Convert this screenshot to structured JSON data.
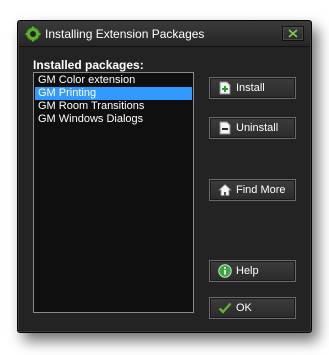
{
  "window": {
    "title": "Installing Extension Packages",
    "app_icon": "gear-icon",
    "close_icon": "close-icon"
  },
  "packages": {
    "label": "Installed packages:",
    "items": [
      {
        "name": "GM Color extension",
        "selected": false
      },
      {
        "name": "GM Printing",
        "selected": true
      },
      {
        "name": "GM Room Transitions",
        "selected": false
      },
      {
        "name": "GM Windows Dialogs",
        "selected": false
      }
    ]
  },
  "buttons": {
    "install": {
      "label": "Install",
      "icon": "install-icon"
    },
    "uninstall": {
      "label": "Uninstall",
      "icon": "uninstall-icon"
    },
    "find_more": {
      "label": "Find More",
      "icon": "home-icon"
    },
    "help": {
      "label": "Help",
      "icon": "info-icon"
    },
    "ok": {
      "label": "OK",
      "icon": "checkmark-icon"
    }
  },
  "colors": {
    "accent": "#3399ff",
    "brand_green": "#5fb030"
  }
}
